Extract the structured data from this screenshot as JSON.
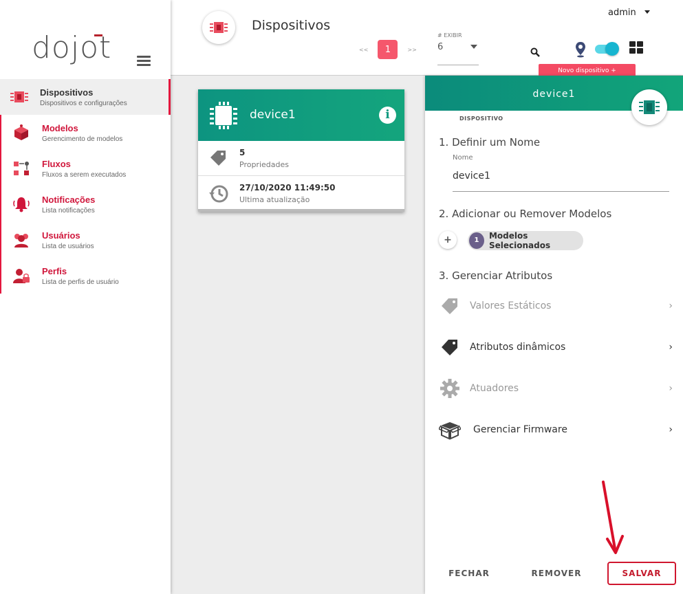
{
  "logo": {
    "text": "dojot"
  },
  "sidebar": {
    "items": [
      {
        "label": "Dispositivos",
        "sub": "Dispositivos e configurações"
      },
      {
        "label": "Modelos",
        "sub": "Gerencimento de modelos"
      },
      {
        "label": "Fluxos",
        "sub": "Fluxos a serem executados"
      },
      {
        "label": "Notificações",
        "sub": "Lista notificações"
      },
      {
        "label": "Usuários",
        "sub": "Lista de usuários"
      },
      {
        "label": "Perfis",
        "sub": "Lista de perfis de usuário"
      }
    ]
  },
  "header": {
    "title": "Dispositivos",
    "pager": {
      "prev": "<<",
      "page": "1",
      "next": ">>"
    },
    "exibir": {
      "label": "# EXIBIR",
      "value": "6"
    },
    "user": "admin",
    "new_device": "Novo dispositivo +"
  },
  "card": {
    "name": "device1",
    "info_symbol": "i",
    "properties": {
      "value": "5",
      "label": "Propriedades"
    },
    "updated": {
      "value": "27/10/2020 11:49:50",
      "label": "Ultima atualização"
    }
  },
  "panel": {
    "title": "device1",
    "section_label": "DISPOSITIVO",
    "step1": "1. Definir um Nome",
    "name_label": "Nome",
    "name_value": "device1",
    "step2": "2. Adicionar ou Remover Modelos",
    "add_symbol": "+",
    "models_count": "1",
    "models_label": "Modelos Selecionados",
    "step3": "3. Gerenciar Atributos",
    "attributes": [
      {
        "label": "Valores Estáticos"
      },
      {
        "label": "Atributos dinâmicos"
      },
      {
        "label": "Atuadores"
      },
      {
        "label": "Gerenciar Firmware"
      }
    ],
    "chevron": "›",
    "buttons": {
      "close": "FECHAR",
      "remove": "REMOVER",
      "save": "SALVAR"
    }
  },
  "colors": {
    "accent": "#e3173e",
    "teal": "#0d9480",
    "save_border": "#d0162e"
  }
}
